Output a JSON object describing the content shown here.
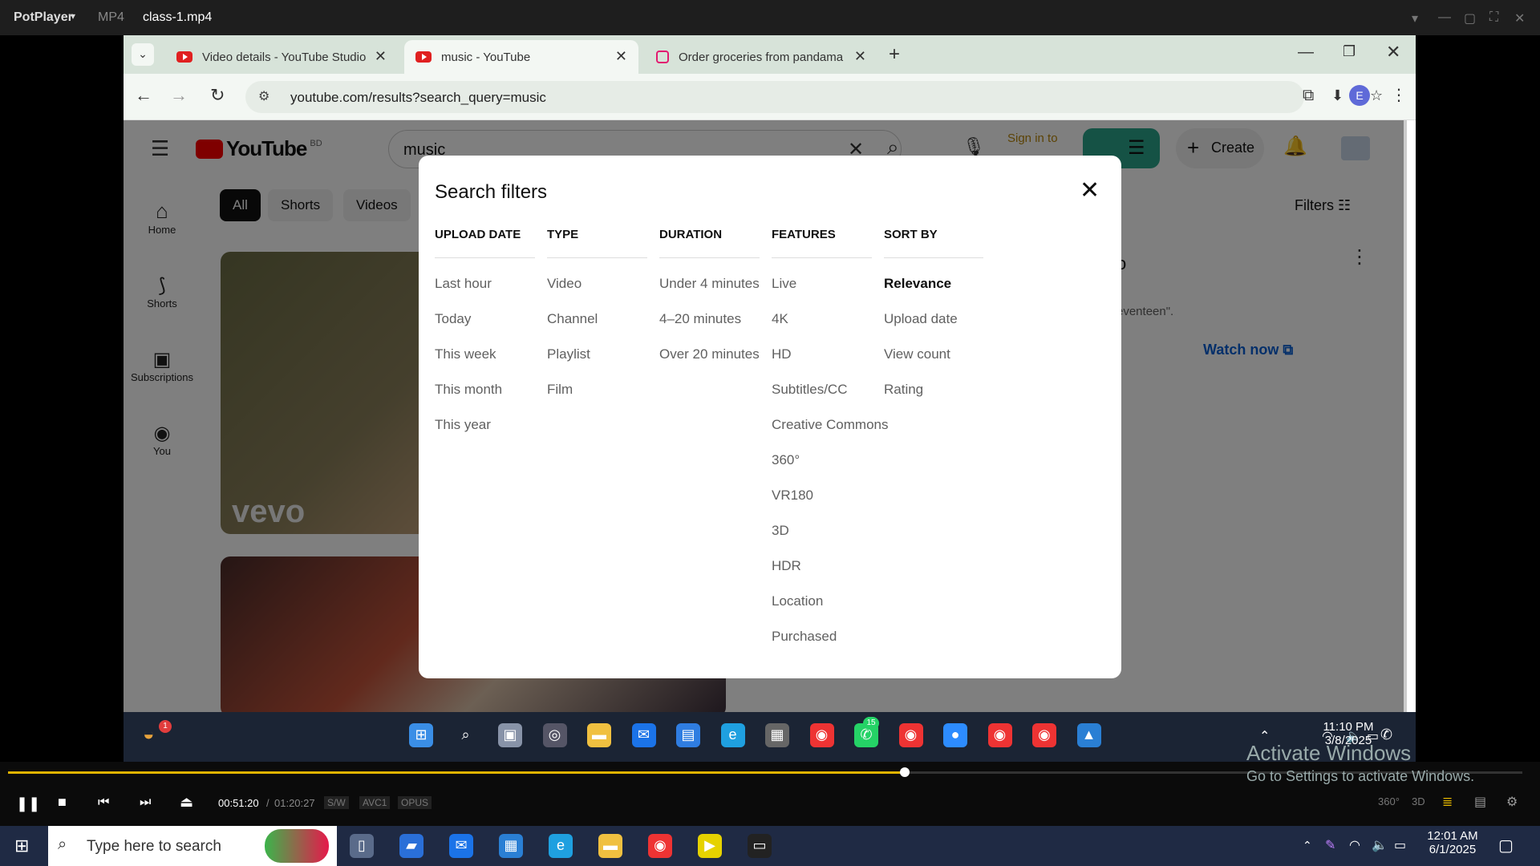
{
  "potplayer": {
    "app": "PotPlayer",
    "format": "MP4",
    "file": "class-1.mp4",
    "time_current": "00:51:20",
    "time_sep": "/",
    "time_total": "01:20:27",
    "tag_sw": "S/W",
    "tag_codec": "AVC1",
    "tag_audio": "OPUS",
    "badge_360": "360°",
    "badge_3d": "3D",
    "progress_fraction": 0.592
  },
  "browser": {
    "tabs": [
      {
        "label": "Video details - YouTube Studio"
      },
      {
        "label": "music - YouTube"
      },
      {
        "label": "Order groceries from pandama"
      }
    ],
    "url": "youtube.com/results?search_query=music",
    "profile_initial": "E"
  },
  "youtube": {
    "logo": "YouTube",
    "region": "BD",
    "search_value": "music",
    "sign_in": "Sign in to",
    "create": "Create",
    "filters": "Filters",
    "nav": [
      {
        "label": "Home"
      },
      {
        "label": "Shorts"
      },
      {
        "label": "Subscriptions"
      },
      {
        "label": "You"
      }
    ],
    "chips": [
      "All",
      "Shorts",
      "Videos"
    ],
    "vevo": "vevo",
    "bg_title_fragment": "o",
    "bg_desc_fragment": "eventeen\".",
    "watch_now": "Watch now"
  },
  "filters_dialog": {
    "title": "Search filters",
    "columns": [
      {
        "heading": "UPLOAD DATE",
        "options": [
          "Last hour",
          "Today",
          "This week",
          "This month",
          "This year"
        ]
      },
      {
        "heading": "TYPE",
        "options": [
          "Video",
          "Channel",
          "Playlist",
          "Film"
        ]
      },
      {
        "heading": "DURATION",
        "options": [
          "Under 4 minutes",
          "4–20 minutes",
          "Over 20 minutes"
        ]
      },
      {
        "heading": "FEATURES",
        "options": [
          "Live",
          "4K",
          "HD",
          "Subtitles/CC",
          "Creative Commons",
          "360°",
          "VR180",
          "3D",
          "HDR",
          "Location",
          "Purchased"
        ]
      },
      {
        "heading": "SORT BY",
        "options": [
          "Relevance",
          "Upload date",
          "View count",
          "Rating"
        ]
      }
    ],
    "selected_sort": "Relevance"
  },
  "inner_taskbar": {
    "time": "11:10 PM",
    "date": "3/8/2025",
    "notify_badge": "1",
    "whatsapp_badge": "15"
  },
  "watermark": {
    "line1": "Activate Windows",
    "line2": "Go to Settings to activate Windows."
  },
  "windows_taskbar": {
    "search_placeholder": "Type here to search",
    "time": "12:01 AM",
    "date": "6/1/2025"
  },
  "colors": {
    "accent_red": "#ff0000",
    "chrome_tab_bg": "#d7e3d9",
    "taskbar": "#1f2a44",
    "seek": "#e0b400"
  }
}
